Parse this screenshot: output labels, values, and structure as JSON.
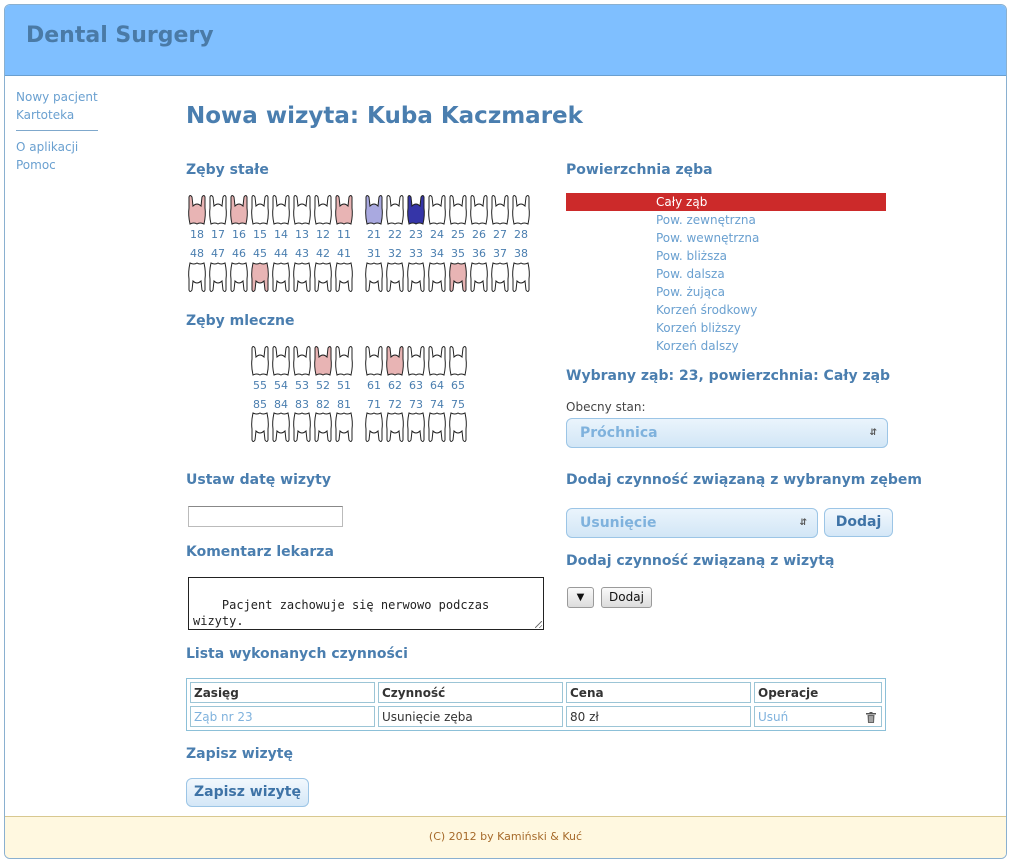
{
  "app": {
    "title": "Dental Surgery"
  },
  "sidebar": {
    "items": [
      "Nowy pacjent",
      "Kartoteka"
    ],
    "items2": [
      "O aplikacji",
      "Pomoc"
    ]
  },
  "page_title": "Nowa wizyta: Kuba Kaczmarek",
  "sections": {
    "permanent": "Zęby stałe",
    "milk": "Zęby mleczne",
    "surface": "Powierzchnia zęba",
    "selected": "Wybrany ząb: 23, powierzchnia: Cały ząb",
    "current_state_label": "Obecny stan:",
    "add_tooth_action": "Dodaj czynność związaną z wybranym zębem",
    "add_visit_action": "Dodaj czynność związaną z wizytą",
    "set_date": "Ustaw datę wizyty",
    "comment": "Komentarz lekarza",
    "list": "Lista wykonanych czynności",
    "save": "Zapisz wizytę"
  },
  "teeth": {
    "upper_right": [
      "18",
      "17",
      "16",
      "15",
      "14",
      "13",
      "12",
      "11"
    ],
    "upper_left": [
      "21",
      "22",
      "23",
      "24",
      "25",
      "26",
      "27",
      "28"
    ],
    "lower_right": [
      "48",
      "47",
      "46",
      "45",
      "44",
      "43",
      "42",
      "41"
    ],
    "lower_left": [
      "31",
      "32",
      "33",
      "34",
      "35",
      "36",
      "37",
      "38"
    ],
    "milk_upper_right": [
      "55",
      "54",
      "53",
      "52",
      "51"
    ],
    "milk_upper_left": [
      "61",
      "62",
      "63",
      "64",
      "65"
    ],
    "milk_lower_right": [
      "85",
      "84",
      "83",
      "82",
      "81"
    ],
    "milk_lower_left": [
      "71",
      "72",
      "73",
      "74",
      "75"
    ],
    "states": {
      "18": "decay",
      "16": "decay",
      "11": "decay",
      "21": "treated",
      "23": "selected",
      "45": "decay",
      "35": "decay",
      "52": "decay",
      "62": "decay"
    },
    "colors": {
      "decay": "#e8b4b4",
      "treated": "#a9a9e0",
      "selected": "#3535a8",
      "healthy": "#ffffff"
    }
  },
  "surfaces": [
    "Cały ząb",
    "Pow. zewnętrzna",
    "Pow. wewnętrzna",
    "Pow. bliższa",
    "Pow. dalsza",
    "Pow. żująca",
    "Korzeń środkowy",
    "Korzeń bliższy",
    "Korzeń dalszy"
  ],
  "surface_selected_index": 0,
  "current_state_value": "Próchnica",
  "tooth_action_value": "Usunięcie",
  "add_button": "Dodaj",
  "visit_action_select": "▼",
  "visit_add_button": "Dodaj",
  "date_value": "",
  "comment_text": "Pacjent zachowuje się nerwowo podczas\nwizyty.",
  "table": {
    "headers": [
      "Zasięg",
      "Czynność",
      "Cena",
      "Operacje"
    ],
    "rows": [
      [
        "Ząb nr 23",
        "Usunięcie zęba",
        "80 zł",
        "Usuń"
      ]
    ]
  },
  "save_button": "Zapisz wizytę",
  "footer": "(C) 2012 by Kamiński & Kuć"
}
